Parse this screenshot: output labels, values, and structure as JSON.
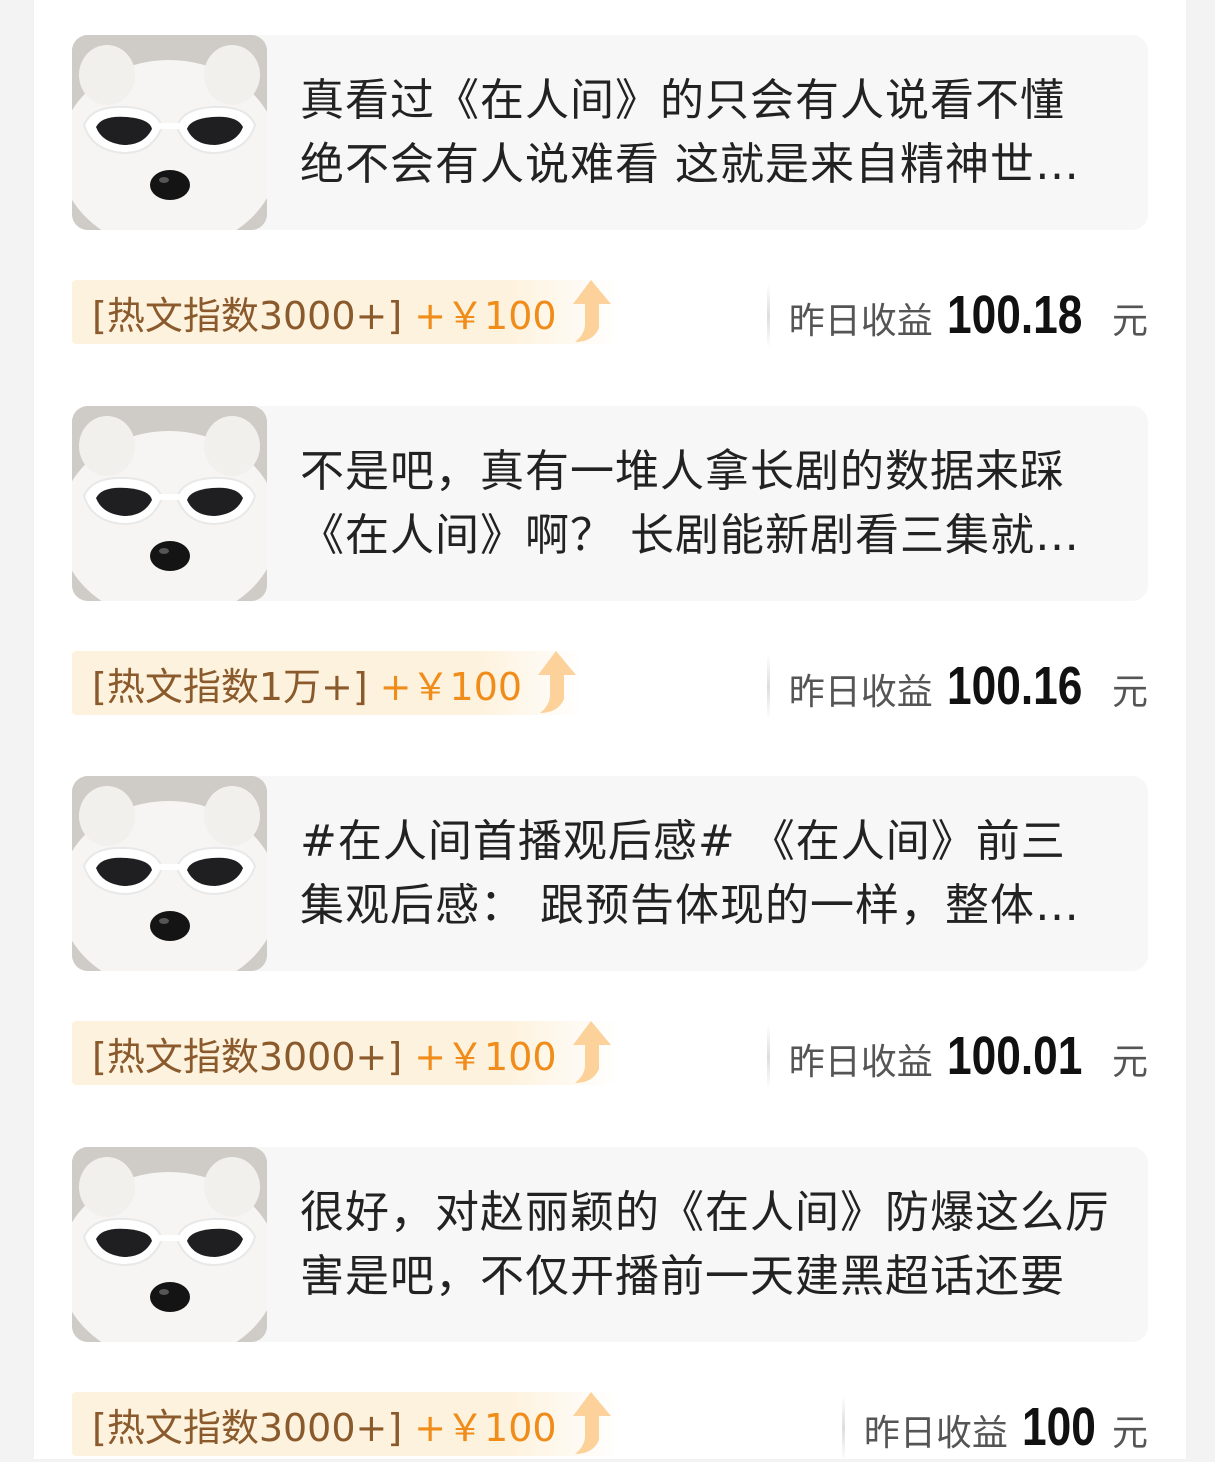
{
  "income_label": "昨日收益",
  "income_unit": "元",
  "colors": {
    "badge_bg": "#fdf2dd",
    "badge_label": "#8a5a2c",
    "badge_reward": "#f08c1a",
    "card_bg": "#f7f7f7"
  },
  "icons": {
    "thumbnail": "samoyed-sunglasses-avatar",
    "badge_arrow": "up-arrow-icon"
  },
  "posts": [
    {
      "text": "真看过《在人间》的只会有人说看不懂 绝不会有人说难看 这就是来自精神世界的碰撞",
      "badge_label": "[热文指数3000+]",
      "badge_reward": "+￥100",
      "income_value": "100.18"
    },
    {
      "text": "不是吧，真有一堆人拿长剧的数据来踩《在人间》啊？ 长剧能新剧看三集就弃吗",
      "badge_label": "[热文指数1万+]",
      "badge_reward": "+￥100",
      "income_value": "100.16"
    },
    {
      "text": "#在人间首播观后感# 《在人间》前三集观后感： 跟预告体现的一样，整体风格",
      "badge_label": "[热文指数3000+]",
      "badge_reward": "+￥100",
      "income_value": "100.01"
    },
    {
      "text": "很好，对赵丽颖的《在人间》防爆这么厉害是吧，不仅开播前一天建黑超话还要",
      "badge_label": "[热文指数3000+]",
      "badge_reward": "+￥100",
      "income_value": "100"
    }
  ]
}
